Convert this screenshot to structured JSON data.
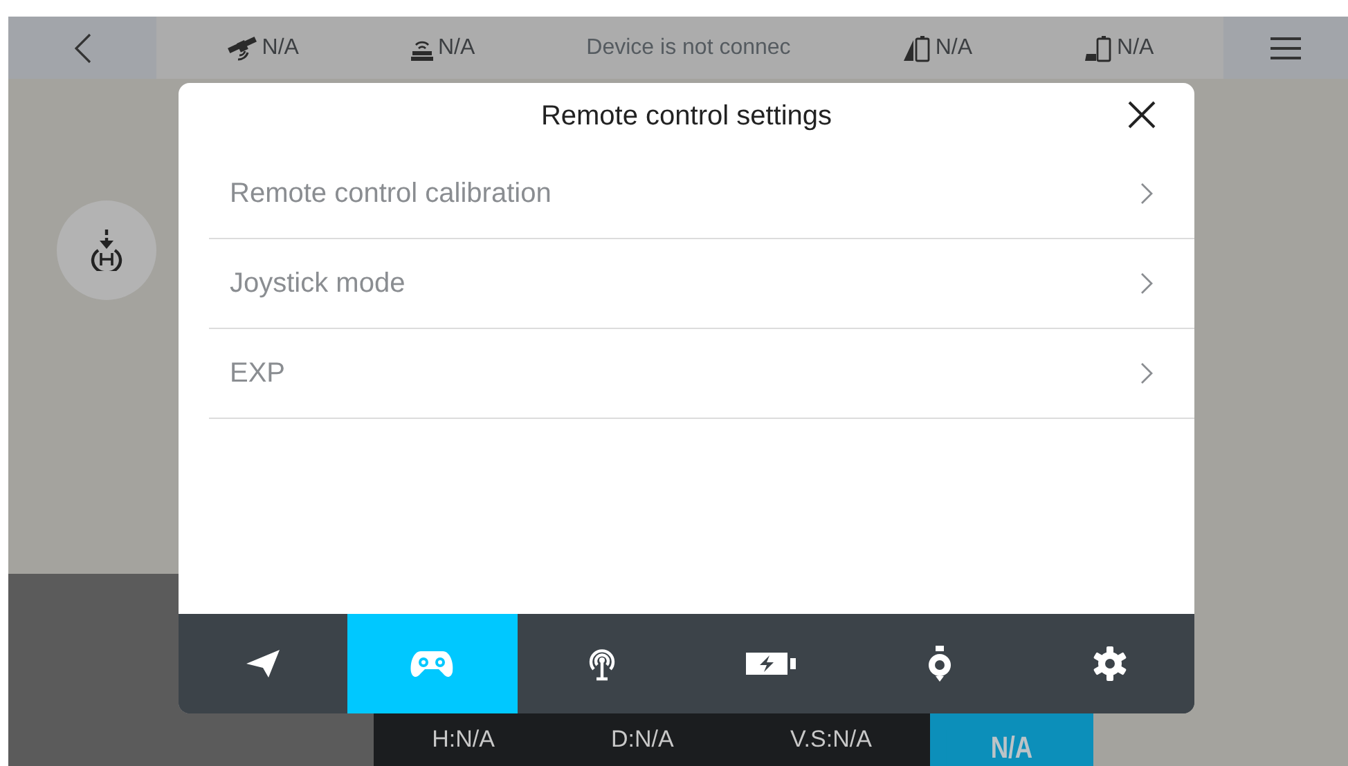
{
  "top_bar": {
    "status": [
      {
        "kind": "satellite",
        "value": "N/A"
      },
      {
        "kind": "signal",
        "value": "N/A"
      },
      {
        "kind": "message",
        "value": "Device is not connec"
      },
      {
        "kind": "rc_battery",
        "value": "N/A"
      },
      {
        "kind": "drone_battery",
        "value": "N/A"
      }
    ]
  },
  "modal": {
    "title": "Remote control settings",
    "items": [
      {
        "label": "Remote control calibration"
      },
      {
        "label": "Joystick mode"
      },
      {
        "label": "EXP"
      }
    ],
    "tabs": [
      {
        "kind": "aircraft",
        "selected": false
      },
      {
        "kind": "gamepad",
        "selected": true
      },
      {
        "kind": "antenna",
        "selected": false
      },
      {
        "kind": "battery",
        "selected": false
      },
      {
        "kind": "gimbal",
        "selected": false
      },
      {
        "kind": "settings",
        "selected": false
      }
    ]
  },
  "telemetry": {
    "readings": [
      "H:N/A",
      "D:N/A",
      "V.S:N/A"
    ],
    "badge": "N/A"
  }
}
